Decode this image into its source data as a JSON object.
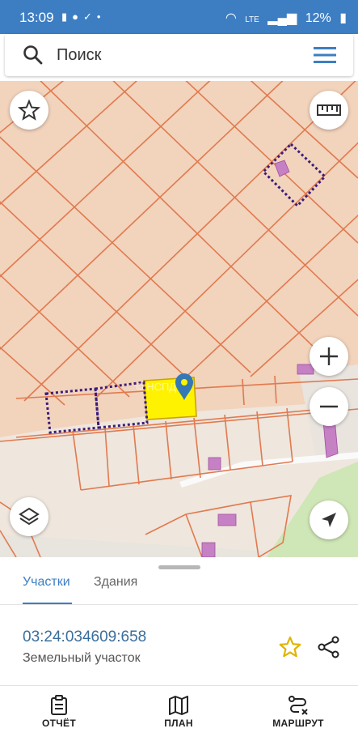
{
  "status_bar": {
    "time": "13:09",
    "battery": "12%",
    "network": "LTE"
  },
  "search": {
    "placeholder": "Поиск"
  },
  "map": {
    "watermark": "© НСПД"
  },
  "tabs": [
    {
      "label": "Участки",
      "active": true
    },
    {
      "label": "Здания",
      "active": false
    }
  ],
  "parcel": {
    "cadastral_number": "03:24:034609:658",
    "type": "Земельный участок"
  },
  "bottom_nav": [
    {
      "label": "ОТЧЁТ",
      "icon": "report-icon"
    },
    {
      "label": "ПЛАН",
      "icon": "map-icon"
    },
    {
      "label": "МАРШРУТ",
      "icon": "route-icon"
    }
  ],
  "colors": {
    "accent": "#3d7ec3",
    "parcel_highlight": "#fff200",
    "boundary": "#e07a4f",
    "building": "#c680c4"
  }
}
